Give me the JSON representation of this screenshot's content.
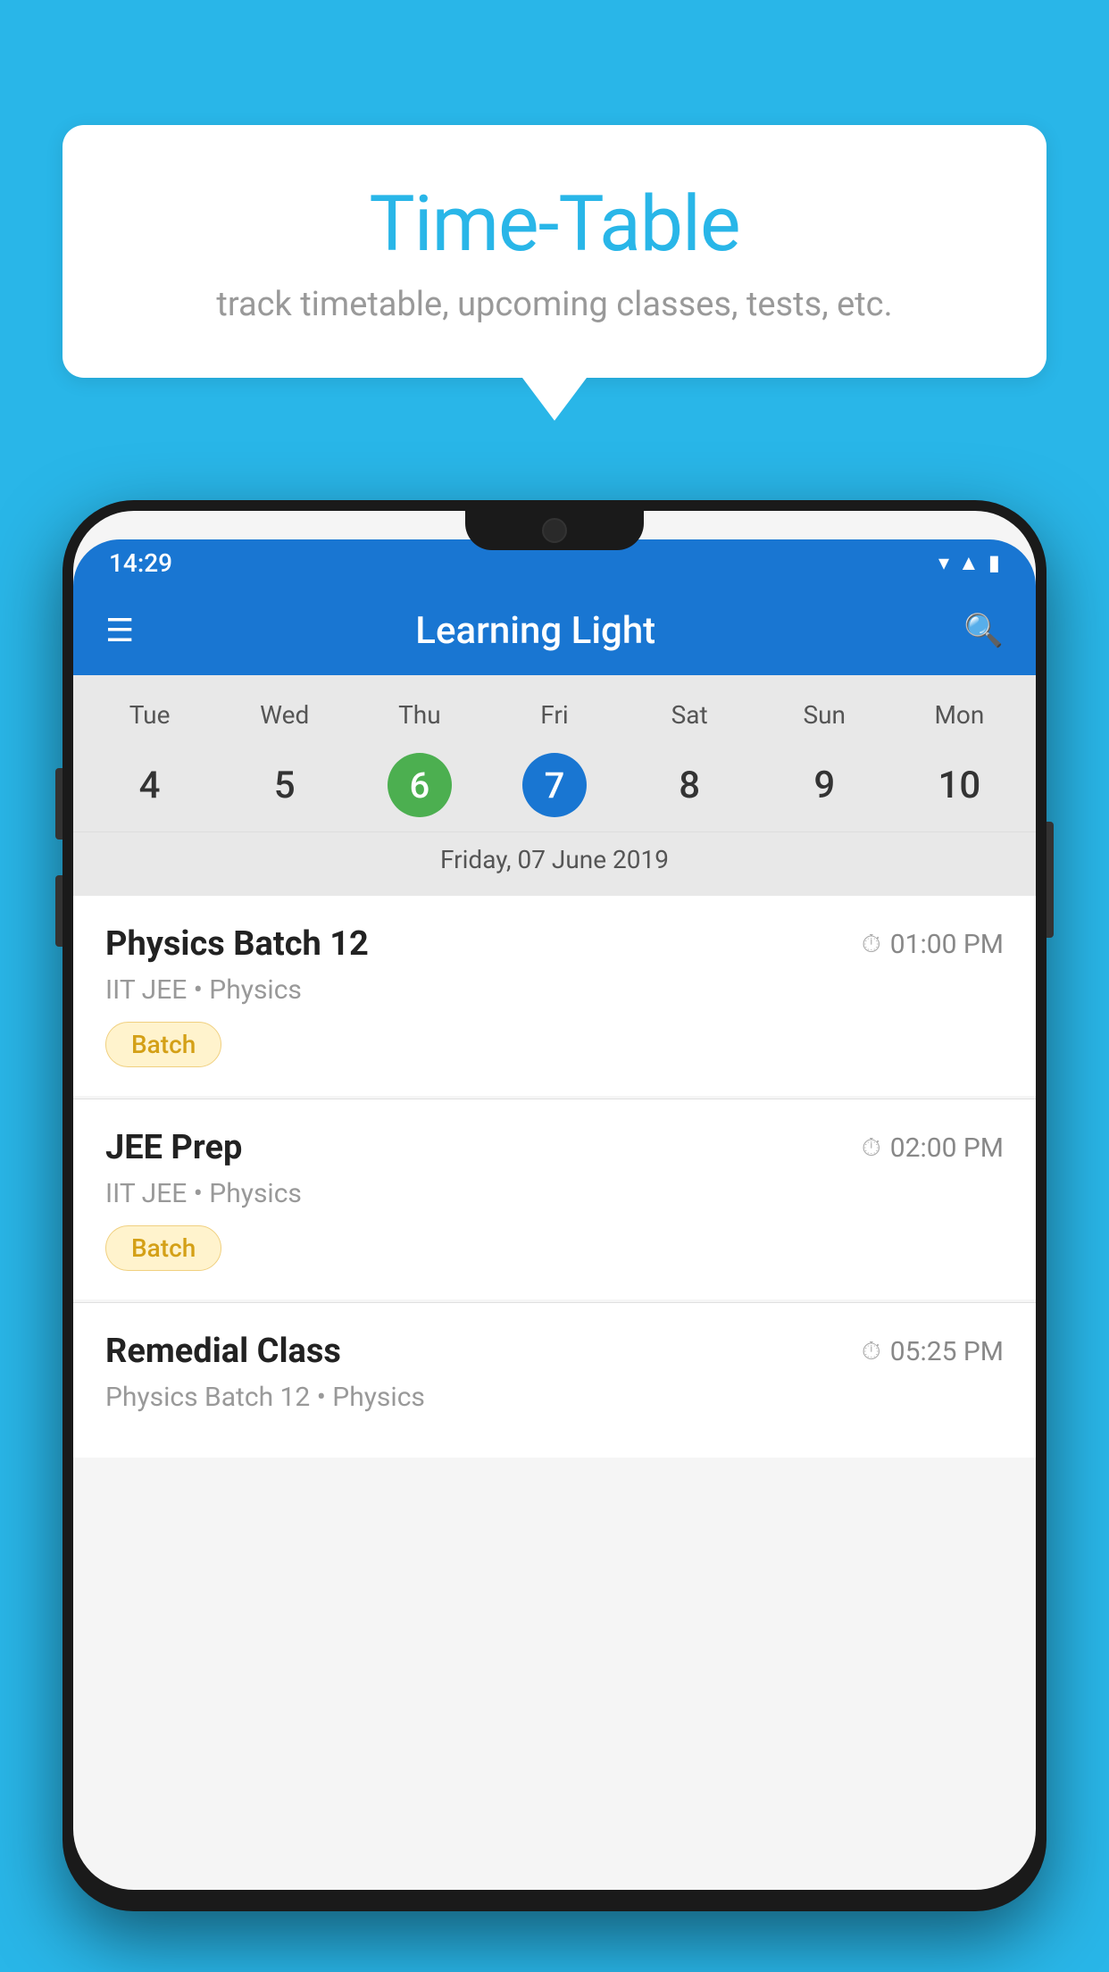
{
  "background": {
    "color": "#29B6E8"
  },
  "speech_bubble": {
    "title": "Time-Table",
    "subtitle": "track timetable, upcoming classes, tests, etc."
  },
  "phone": {
    "status_bar": {
      "time": "14:29"
    },
    "app_bar": {
      "title": "Learning Light"
    },
    "calendar": {
      "days": [
        {
          "name": "Tue",
          "number": "4",
          "state": "normal"
        },
        {
          "name": "Wed",
          "number": "5",
          "state": "normal"
        },
        {
          "name": "Thu",
          "number": "6",
          "state": "today"
        },
        {
          "name": "Fri",
          "number": "7",
          "state": "selected"
        },
        {
          "name": "Sat",
          "number": "8",
          "state": "normal"
        },
        {
          "name": "Sun",
          "number": "9",
          "state": "normal"
        },
        {
          "name": "Mon",
          "number": "10",
          "state": "normal"
        }
      ],
      "selected_date_label": "Friday, 07 June 2019"
    },
    "schedule": [
      {
        "title": "Physics Batch 12",
        "time": "01:00 PM",
        "subtitle": "IIT JEE • Physics",
        "badge": "Batch"
      },
      {
        "title": "JEE Prep",
        "time": "02:00 PM",
        "subtitle": "IIT JEE • Physics",
        "badge": "Batch"
      },
      {
        "title": "Remedial Class",
        "time": "05:25 PM",
        "subtitle": "Physics Batch 12 • Physics",
        "badge": null
      }
    ]
  }
}
